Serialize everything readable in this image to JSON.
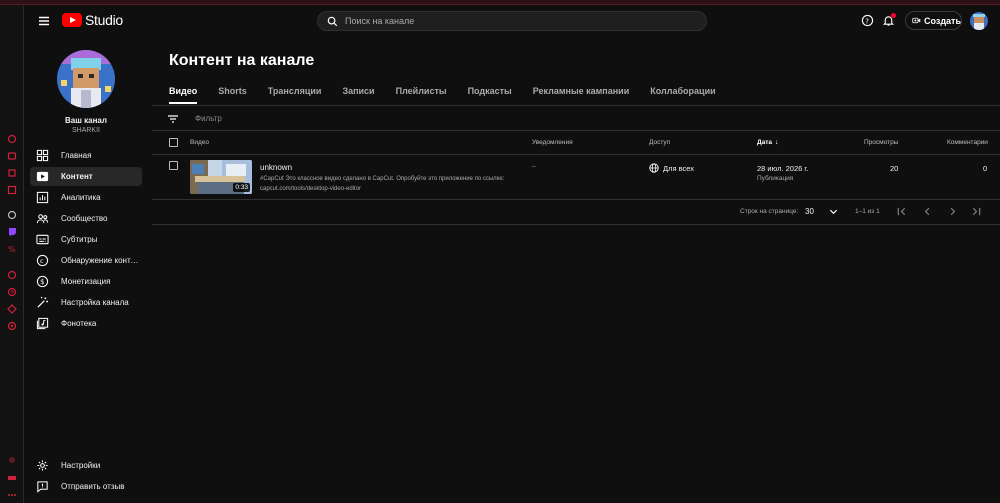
{
  "header": {
    "logo_text": "Studio",
    "search_placeholder": "Поиск на канале",
    "create_label": "Создать",
    "icons": [
      "menu-icon",
      "youtube-logo-icon",
      "search-icon",
      "help-icon",
      "bell-icon",
      "create-video-icon"
    ]
  },
  "sidebar": {
    "channel_label": "Ваш канал",
    "channel_name": "SHARKII",
    "items": [
      {
        "label": "Главная",
        "icon": "dashboard-icon",
        "active": false
      },
      {
        "label": "Контент",
        "icon": "content-icon",
        "active": true
      },
      {
        "label": "Аналитика",
        "icon": "analytics-icon",
        "active": false
      },
      {
        "label": "Сообщество",
        "icon": "community-icon",
        "active": false
      },
      {
        "label": "Субтитры",
        "icon": "subtitles-icon",
        "active": false
      },
      {
        "label": "Обнаружение контен...",
        "icon": "copyright-icon",
        "active": false
      },
      {
        "label": "Монетизация",
        "icon": "monetization-icon",
        "active": false
      },
      {
        "label": "Настройка канала",
        "icon": "customization-icon",
        "active": false
      },
      {
        "label": "Фонотека",
        "icon": "audio-library-icon",
        "active": false
      }
    ],
    "bottom_items": [
      {
        "label": "Настройки",
        "icon": "settings-icon"
      },
      {
        "label": "Отправить отзыв",
        "icon": "feedback-icon"
      }
    ]
  },
  "main": {
    "title": "Контент на канале",
    "tabs": [
      "Видео",
      "Shorts",
      "Трансляции",
      "Записи",
      "Плейлисты",
      "Подкасты",
      "Рекламные кампании",
      "Коллаборации"
    ],
    "active_tab": "Видео",
    "filter_placeholder": "Фильтр",
    "columns": {
      "video": "Видео",
      "notifications": "Уведомления",
      "visibility": "Доступ",
      "date": "Дата",
      "views": "Просмотры",
      "comments": "Комментарии"
    },
    "row": {
      "title": "unknown",
      "description": "#CapCut Это классное видео сделано в CapCut. Опробуйте это приложение по ссылке: capcut.com/tools/desktop-video-editor",
      "duration": "0:33",
      "notifications": "–",
      "visibility": "Для всех",
      "date": "28 июл. 2026 г.",
      "date_sub": "Публикация",
      "views": "20",
      "comments": "0"
    },
    "pager": {
      "rows_label": "Строк на странице:",
      "rows_value": "30",
      "range": "1–1 из 1"
    }
  },
  "colors": {
    "background": "#0f0f0f",
    "accent_red": "#ff0000",
    "active_nav": "#282828",
    "extension_red": "#d0213a"
  }
}
